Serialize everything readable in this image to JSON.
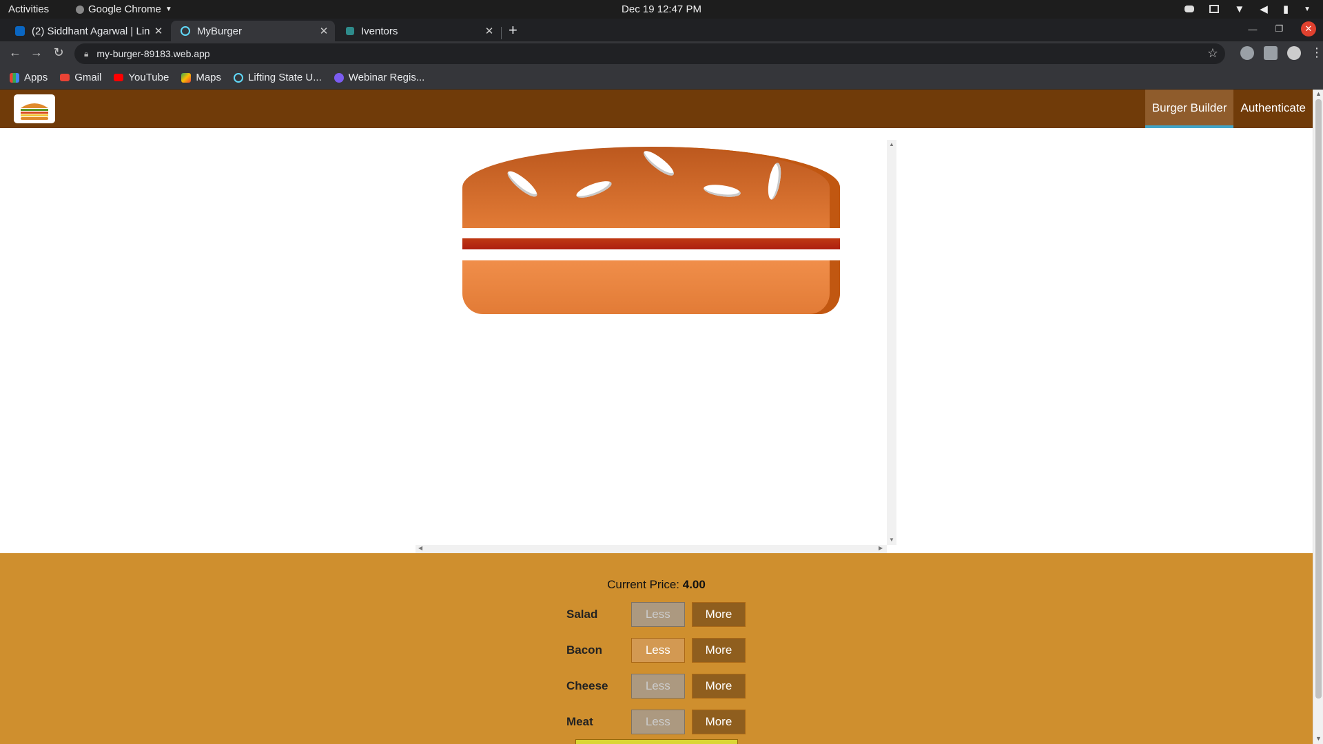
{
  "os": {
    "activities": "Activities",
    "app_name": "Google Chrome",
    "clock": "Dec 19  12:47 PM"
  },
  "browser": {
    "tabs": [
      {
        "title": "(2) Siddhant Agarwal | Lin",
        "close": "✕",
        "favicon": "linkedin-icon"
      },
      {
        "title": "MyBurger",
        "close": "✕",
        "favicon": "react-icon",
        "active": true
      },
      {
        "title": "Iventors",
        "close": "✕",
        "favicon": "iventors-icon"
      }
    ],
    "new_tab": "+",
    "url": "my-burger-89183.web.app",
    "bookmarks": [
      {
        "label": "Apps",
        "icon": "apps-grid-icon"
      },
      {
        "label": "Gmail",
        "icon": "gmail-icon"
      },
      {
        "label": "YouTube",
        "icon": "youtube-icon"
      },
      {
        "label": "Maps",
        "icon": "maps-icon"
      },
      {
        "label": "Lifting State U...",
        "icon": "react-icon"
      },
      {
        "label": "Webinar Regis...",
        "icon": "zoom-icon"
      }
    ]
  },
  "app": {
    "nav": {
      "burger_builder": "Burger Builder",
      "authenticate": "Authenticate"
    },
    "price_label": "Current Price: ",
    "price_value": "4.00",
    "controls": [
      {
        "label": "Salad",
        "less": "Less",
        "more": "More",
        "less_disabled": true
      },
      {
        "label": "Bacon",
        "less": "Less",
        "more": "More",
        "less_disabled": false
      },
      {
        "label": "Cheese",
        "less": "Less",
        "more": "More",
        "less_disabled": true
      },
      {
        "label": "Meat",
        "less": "Less",
        "more": "More",
        "less_disabled": true
      }
    ],
    "colors": {
      "toolbar": "#703b09",
      "controls_bg": "#cf8f2e",
      "active_nav": "#8f5c2c",
      "nav_underline": "#40a4c8"
    }
  }
}
